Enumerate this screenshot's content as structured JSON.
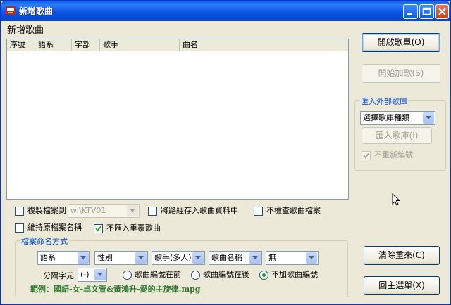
{
  "window": {
    "title": "新增歌曲"
  },
  "heading": "新增歌曲",
  "song_list": {
    "columns": [
      "序號",
      "語系",
      "字部",
      "歌手",
      "曲名"
    ],
    "rows": []
  },
  "buttons": {
    "open_playlist": "開啟歌單(O)",
    "start_add": "開始加歌(S)",
    "import_songbank": "匯入歌庫(I)",
    "clear_reset": "清除重來(C)",
    "main_menu": "回主選單(X)"
  },
  "import_group": {
    "legend": "匯入外部歌庫",
    "songbank_type": "選擇歌庫種類",
    "no_renumber": "不重新編號"
  },
  "options": {
    "copy_file_to": "複製檔案到",
    "copy_path": "w:\\KTV01",
    "save_path": "將路經存入歌曲資料中",
    "no_check": "不檢查歌曲檔案",
    "keep_name": "維持原檔案名稱",
    "no_duplicate": "不匯入重覆歌曲"
  },
  "naming_group": {
    "legend": "檔案命名方式",
    "field1": "語系",
    "field2": "性別",
    "field3": "歌手(多人)",
    "field4": "歌曲名稱",
    "field5": "無",
    "separator_label": "分隔字元",
    "separator": "(-)",
    "radio_before": "歌曲編號在前",
    "radio_after": "歌曲編號在後",
    "radio_none": "不加歌曲編號",
    "example": "範例：國語-女-卓文萱&黃鴻升-愛的主旋律.mpg"
  }
}
